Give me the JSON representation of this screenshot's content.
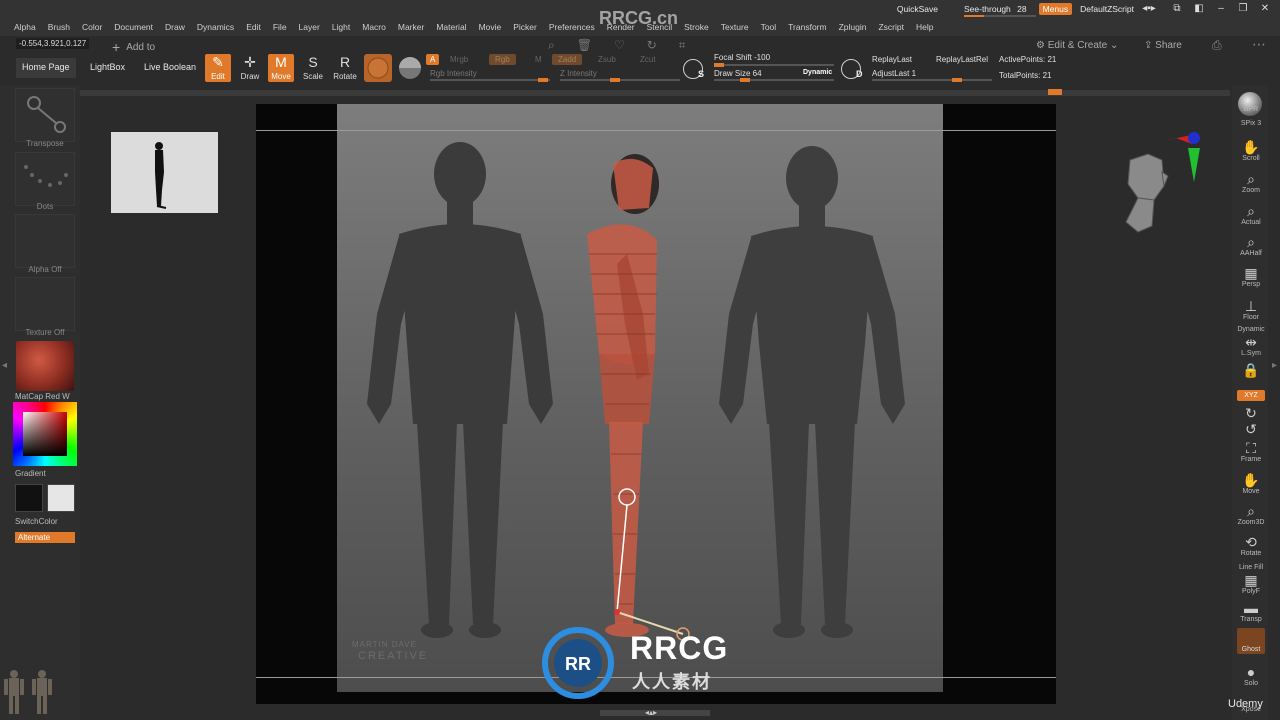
{
  "menubar": {
    "items": [
      "Alpha",
      "Brush",
      "Color",
      "Document",
      "Draw",
      "Dynamics",
      "Edit",
      "File",
      "Layer",
      "Light",
      "Macro",
      "Marker",
      "Material",
      "Movie",
      "Picker",
      "Preferences",
      "Render",
      "Stencil",
      "Stroke",
      "Texture",
      "Tool",
      "Transform",
      "Zplugin",
      "Zscript",
      "Help"
    ],
    "quicksave": "QuickSave",
    "see_through_label": "See-through",
    "see_through_value": "28",
    "see_through_level": 0.28,
    "menus_label": "Menus",
    "zscript_label": "DefaultZScript"
  },
  "header": {
    "coords": "-0.554,3.921,0.127",
    "add_to": "Add to",
    "edit_create": "Edit & Create",
    "share": "Share"
  },
  "toolbar": {
    "home_page": "Home Page",
    "lightbox": "LightBox",
    "live_boolean": "Live Boolean",
    "edit": "Edit",
    "draw": "Draw",
    "move": "Move",
    "scale": "Scale",
    "rotate": "Rotate",
    "a_label": "A",
    "mrgb": "Mrgb",
    "rgb": "Rgb",
    "m": "M",
    "zadd": "Zadd",
    "zsub": "Zsub",
    "zcut": "Zcut",
    "rgb_intensity": "Rgb Intensity",
    "z_intensity": "Z Intensity",
    "focal_shift": "Focal Shift -100",
    "draw_size": "Draw Size 64",
    "dynamic": "Dynamic",
    "s_letter": "S",
    "d_letter": "D",
    "replay_last": "ReplayLast",
    "replay_last_rel": "ReplayLastRel",
    "adjust_last": "AdjustLast 1",
    "active_points": "ActivePoints: 21",
    "total_points": "TotalPoints: 21"
  },
  "leftshelf": {
    "transpose": "Transpose",
    "dots": "Dots",
    "alpha_off": "Alpha Off",
    "texture_off": "Texture Off",
    "matcap": "MatCap Red W",
    "gradient": "Gradient",
    "switchcolor": "SwitchColor",
    "alternate": "Alternate"
  },
  "rightshelf": {
    "bpr": "BPR",
    "spix": "SPix 3",
    "scroll": "Scroll",
    "zoom": "Zoom",
    "actual": "Actual",
    "aahalf": "AAHalf",
    "persp": "Persp",
    "floor": "Floor",
    "dynamic": "Dynamic",
    "lsym": "L.Sym",
    "xyz": "XYZ",
    "frame": "Frame",
    "move": "Move",
    "zoom3d": "Zoom3D",
    "rotate": "Rotate",
    "line_fill": "Line Fill",
    "polyf": "PolyF",
    "transp": "Transp",
    "ghost": "Ghost",
    "solo": "Solo",
    "xpose": "Xpose"
  },
  "canvas": {
    "credit_line1": "MARTIN DAVE",
    "credit_line2": "CREATIVE"
  },
  "watermark": {
    "site": "RRCG.cn",
    "brand": "RRCG",
    "brand_cn": "人人素材"
  },
  "footer": {
    "udemy": "Udemy"
  },
  "colors": {
    "accent": "#e07a2a",
    "bg": "#2b2b2b",
    "skin_red": "#c85a44"
  }
}
